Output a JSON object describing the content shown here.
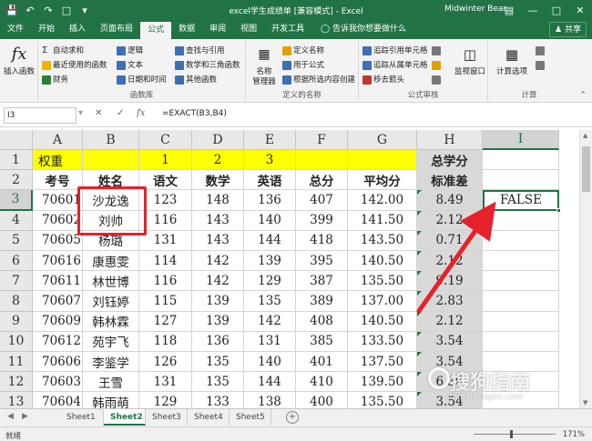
{
  "window": {
    "title": "excel学生成绩单 [兼容模式] - Excel",
    "user": "Midwinter Bear"
  },
  "tabs": [
    "文件",
    "开始",
    "插入",
    "页面布局",
    "公式",
    "数据",
    "审阅",
    "视图",
    "开发工具"
  ],
  "active_tab": "公式",
  "tell_me": "告诉我你想要做什么",
  "share": "共享",
  "ribbon": {
    "insert_function": "插入函数",
    "library": {
      "col1": [
        "自动求和",
        "最近使用的函数",
        "财务"
      ],
      "col2": [
        "逻辑",
        "文本",
        "日期和时间"
      ],
      "col3": [
        "查找与引用",
        "数学和三角函数",
        "其他函数"
      ],
      "label": "函数库"
    },
    "names": {
      "manager": "名称\n管理器",
      "items": [
        "定义名称",
        "用于公式",
        "根据所选内容创建"
      ],
      "label": "定义的名称"
    },
    "audit": {
      "items": [
        "追踪引用单元格",
        "追踪从属单元格",
        "移去箭头"
      ],
      "watch": "监视窗口",
      "label": "公式审核"
    },
    "calc": {
      "options": "计算选项",
      "label": "计算"
    }
  },
  "formula_bar": {
    "name_box": "I3",
    "formula": "=EXACT(B3,B4)"
  },
  "columns": [
    "A",
    "B",
    "C",
    "D",
    "E",
    "F",
    "G",
    "H",
    "I"
  ],
  "rows": [
    [
      "权重",
      "",
      "1",
      "2",
      "3",
      "",
      "",
      "总学分",
      ""
    ],
    [
      "考号",
      "姓名",
      "语文",
      "数学",
      "英语",
      "总分",
      "平均分",
      "标准差",
      ""
    ],
    [
      "70601",
      "沙龙逸",
      "123",
      "148",
      "136",
      "407",
      "142.00",
      "8.49",
      "FALSE"
    ],
    [
      "70602",
      "刘帅",
      "116",
      "143",
      "140",
      "399",
      "141.50",
      "2.12",
      ""
    ],
    [
      "70605",
      "杨璐",
      "131",
      "143",
      "144",
      "418",
      "143.50",
      "0.71",
      ""
    ],
    [
      "70616",
      "康惠雯",
      "114",
      "142",
      "139",
      "395",
      "140.50",
      "2.12",
      ""
    ],
    [
      "70611",
      "林世博",
      "116",
      "142",
      "129",
      "387",
      "135.50",
      "9.19",
      ""
    ],
    [
      "70607",
      "刘钰婷",
      "115",
      "139",
      "135",
      "389",
      "137.00",
      "2.83",
      ""
    ],
    [
      "70609",
      "韩林霖",
      "127",
      "139",
      "142",
      "408",
      "140.50",
      "2.12",
      ""
    ],
    [
      "70612",
      "苑宇飞",
      "118",
      "136",
      "131",
      "385",
      "133.50",
      "3.54",
      ""
    ],
    [
      "70606",
      "李鉴学",
      "126",
      "135",
      "140",
      "401",
      "137.50",
      "3.54",
      ""
    ],
    [
      "70603",
      "王雪",
      "131",
      "135",
      "144",
      "410",
      "139.50",
      "6.36",
      ""
    ],
    [
      "70604",
      "韩雨萌",
      "129",
      "133",
      "138",
      "400",
      "135.50",
      "3.54",
      ""
    ]
  ],
  "sheets": [
    "Sheet1",
    "Sheet2",
    "Sheet3",
    "Sheet4",
    "Sheet5"
  ],
  "active_sheet": "Sheet2",
  "status": {
    "ready": "就绪",
    "zoom": "171%"
  },
  "watermark": {
    "main": "搜狗指南",
    "sub": "zhinan.sogou.com"
  }
}
